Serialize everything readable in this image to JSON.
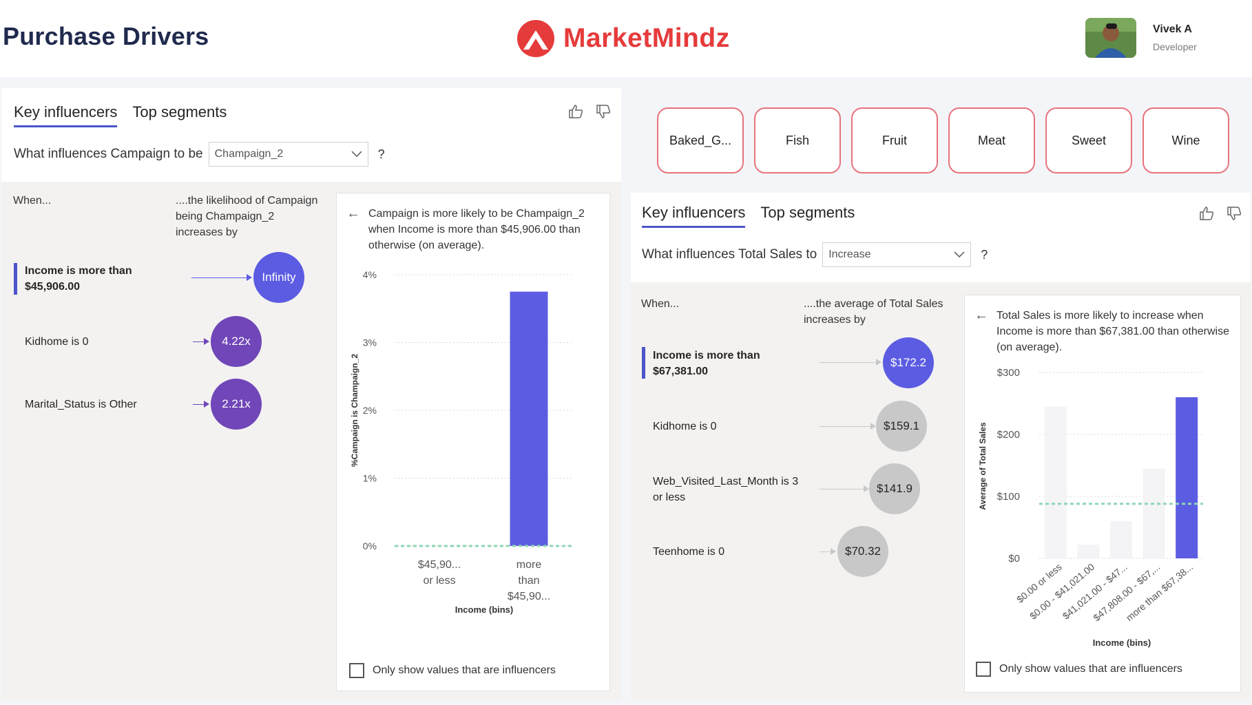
{
  "header": {
    "title": "Purchase Drivers",
    "brand": "MarketMindz",
    "user_name": "Vivek A",
    "user_role": "Developer"
  },
  "colors": {
    "accent": "#4c55c9",
    "bubble_primary": "#5b5ce2",
    "bubble_secondary": "#7046b8",
    "bubble_gray": "#c8c8c8",
    "brand_red": "#e63b3b",
    "category_border": "#e8727c",
    "baseline": "#8fd6b6"
  },
  "left_panel": {
    "tabs": [
      "Key influencers",
      "Top segments"
    ],
    "question_prefix": "What influences Campaign to be",
    "dropdown_value": "Champaign_2",
    "question_mark": "?",
    "col_when": "When...",
    "col_likelihood": "....the likelihood of Campaign being Champaign_2 increases by",
    "influencers": [
      {
        "label": "Income is more than $45,906.00",
        "value": "Infinity"
      },
      {
        "label": "Kidhome is 0",
        "value": "4.22x"
      },
      {
        "label": "Marital_Status is Other",
        "value": "2.21x"
      }
    ],
    "detail_text": "Campaign is more likely to be Champaign_2 when Income is more than $45,906.00 than otherwise (on average).",
    "checkbox_label": "Only show values that are influencers",
    "chart_data": {
      "type": "bar",
      "ylabel": "%Campaign is Champaign_2",
      "xlabel": "Income (bins)",
      "y_ticks": [
        "4%",
        "3%",
        "2%",
        "1%",
        "0%"
      ],
      "ylim": [
        0,
        4
      ],
      "categories": [
        "$45,90... or less",
        "more than $45,90..."
      ],
      "values": [
        0,
        3.75
      ],
      "baseline": 0,
      "grid": true
    }
  },
  "categories": [
    "Baked_G...",
    "Fish",
    "Fruit",
    "Meat",
    "Sweet",
    "Wine"
  ],
  "right_panel": {
    "tabs": [
      "Key influencers",
      "Top segments"
    ],
    "question_prefix": "What influences Total Sales to",
    "dropdown_value": "Increase",
    "question_mark": "?",
    "col_when": "When...",
    "col_average": "....the average of Total Sales increases by",
    "influencers": [
      {
        "label": "Income is more than $67,381.00",
        "value": "$172.2"
      },
      {
        "label": "Kidhome is 0",
        "value": "$159.1"
      },
      {
        "label": "Web_Visited_Last_Month is 3 or less",
        "value": "$141.9"
      },
      {
        "label": "Teenhome is 0",
        "value": "$70.32"
      }
    ],
    "detail_text": "Total Sales is more likely to increase when Income is more than $67,381.00 than otherwise (on average).",
    "checkbox_label": "Only show values that are influencers",
    "chart_data": {
      "type": "bar",
      "ylabel": "Average of Total Sales",
      "xlabel": "Income (bins)",
      "y_ticks": [
        "$300",
        "$200",
        "$100",
        "$0"
      ],
      "ylim": [
        0,
        300
      ],
      "categories": [
        "$0.00 or less",
        "$0.00 - $41,021.00",
        "$41,021.00 - $47...",
        "$47,808.00 - $67,...",
        "more than $67,38..."
      ],
      "values": [
        245,
        22,
        60,
        145,
        260
      ],
      "highlighted_index": 4,
      "baseline": 88,
      "grid": true
    }
  }
}
